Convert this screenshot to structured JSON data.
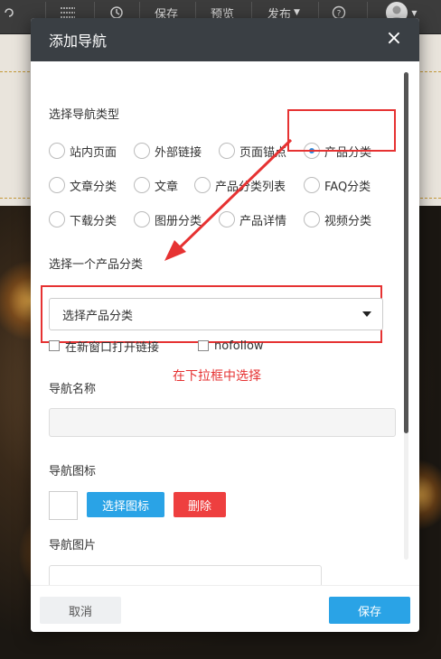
{
  "toolbar": {
    "save_label": "保存",
    "preview_label": "预览",
    "publish_label": "发布"
  },
  "modal": {
    "title": "添加导航",
    "nav_type_label": "选择导航类型",
    "nav_types": [
      {
        "label": "站内页面",
        "checked": false
      },
      {
        "label": "外部链接",
        "checked": false
      },
      {
        "label": "页面锚点",
        "checked": false
      },
      {
        "label": "产品分类",
        "checked": true
      },
      {
        "label": "文章分类",
        "checked": false
      },
      {
        "label": "文章",
        "checked": false
      },
      {
        "label": "产品分类列表",
        "checked": false
      },
      {
        "label": "FAQ分类",
        "checked": false
      },
      {
        "label": "下载分类",
        "checked": false
      },
      {
        "label": "图册分类",
        "checked": false
      },
      {
        "label": "产品详情",
        "checked": false
      },
      {
        "label": "视频分类",
        "checked": false
      }
    ],
    "category_label": "选择一个产品分类",
    "category_select_value": "选择产品分类",
    "open_new_window_label": "在新窗口打开链接",
    "nofollow_label": "nofollow",
    "annotation": "在下拉框中选择",
    "nav_name_label": "导航名称",
    "nav_name_value": "",
    "nav_icon_label": "导航图标",
    "select_icon_button": "选择图标",
    "delete_button": "删除",
    "nav_image_label": "导航图片",
    "cancel_button": "取消",
    "save_button": "保存"
  },
  "colors": {
    "accent_blue": "#2aa3e6",
    "danger_red": "#ee3f3f",
    "annotation_red": "#e63232",
    "header_dark": "#3a3f44"
  }
}
